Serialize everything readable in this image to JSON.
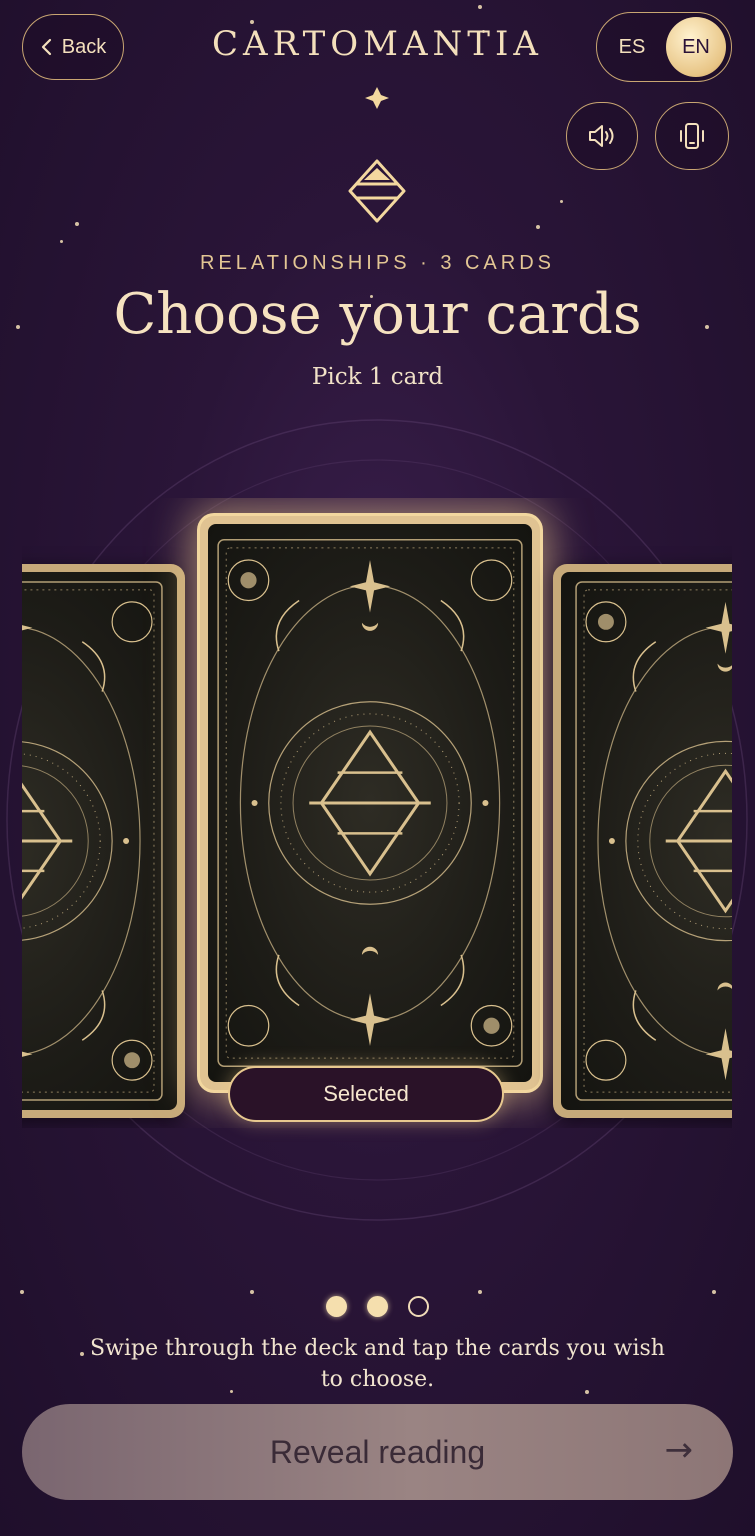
{
  "header": {
    "back_label": "Back",
    "brand": "CARTOMANTIA",
    "languages": [
      "ES",
      "EN"
    ],
    "active_language": "EN"
  },
  "intro": {
    "kicker": "RELATIONSHIPS · 3 CARDS",
    "title": "Choose your cards",
    "subtitle": "Pick 1 card"
  },
  "deck": {
    "selected_label": "Selected",
    "pagination": {
      "total": 3,
      "filled": 2
    }
  },
  "footer": {
    "hint": "Swipe through the deck and tap the cards you wish to choose.",
    "reveal_label": "Reveal reading",
    "reveal_arrow": "→"
  },
  "icons": {
    "back": "chevron-left-icon",
    "sound": "speaker-icon",
    "vibration": "phone-vibrate-icon",
    "emblem": "sigil-icon"
  },
  "colors": {
    "background": "#2a1538",
    "gold": "#e8c586",
    "text": "#f6e2c0"
  }
}
